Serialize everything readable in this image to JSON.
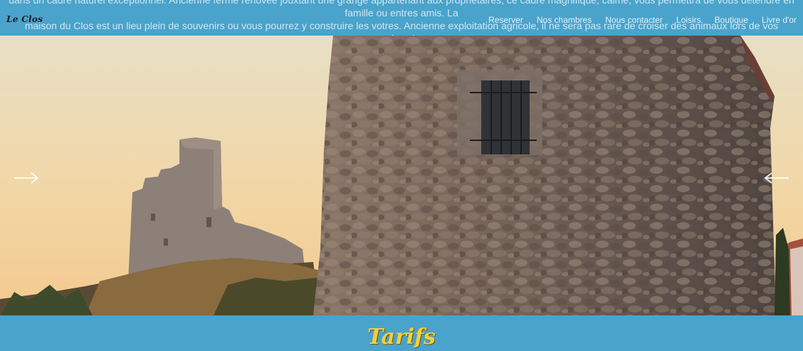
{
  "header": {
    "intro_line1": "dans un cadre naturel exceptionnel. Ancienne ferme rénovée jouxtant une grange appartenant aux propriétaires, ce cadre magnifique, calme, vous permettra de vous détendre en famille ou entres amis. La",
    "intro_line2": "maison du Clos est un lieu plein de souvenirs ou vous pourrez y construire les votres. Ancienne exploitation agricole, il ne sera pas rare de croiser des animaux lors de vos randonnées.",
    "brand": "Le Clos",
    "nav": [
      {
        "label": "Reserver"
      },
      {
        "label": "Nos chambres"
      },
      {
        "label": "Nous contacter"
      },
      {
        "label": "Loisirs"
      },
      {
        "label": "Boutique"
      },
      {
        "label": "Livre d'or"
      }
    ]
  },
  "carousel": {
    "prev_icon": "arrow-right-icon",
    "next_icon": "arrow-left-icon"
  },
  "section": {
    "title": "Tarifs"
  },
  "colors": {
    "accent": "#4aa3cb",
    "title": "#f5cf3a"
  }
}
